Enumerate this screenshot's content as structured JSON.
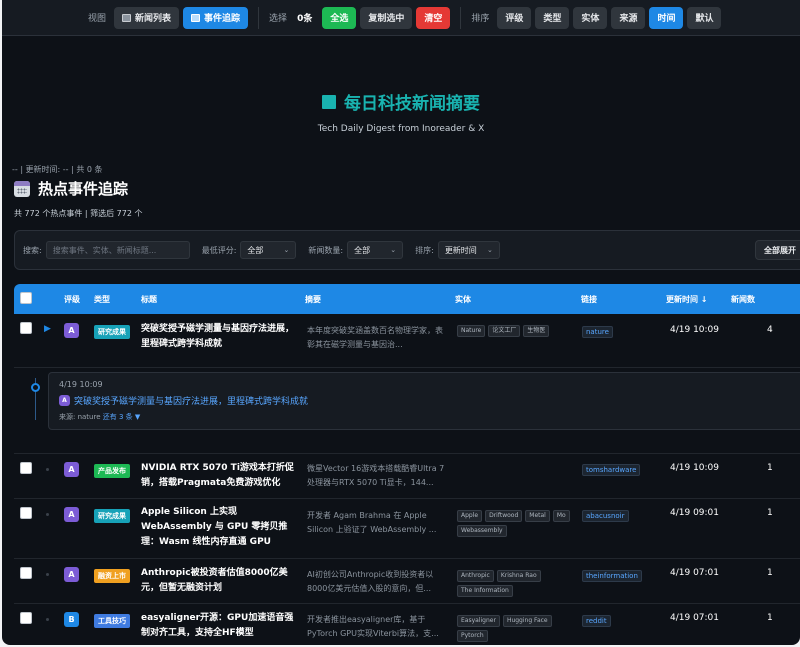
{
  "toolbar": {
    "view_label": "视图",
    "view_news": "新闻列表",
    "view_events": "事件追踪",
    "select_label": "选择",
    "selected_count": "0条",
    "select_all": "全选",
    "copy_selected": "复制选中",
    "clear": "清空",
    "sort_label": "排序",
    "sort_options": [
      "评级",
      "类型",
      "实体",
      "来源",
      "时间",
      "默认"
    ],
    "active_sort": "时间"
  },
  "hero": {
    "title": "每日科技新闻摘要",
    "subtitle": "Tech Daily Digest from Inoreader & X"
  },
  "meta_line": "-- | 更新时间: -- | 共 0 条",
  "section": {
    "title": "热点事件追踪",
    "stats": "共 772 个热点事件 | 筛选后 772 个"
  },
  "filters": {
    "search_label": "搜索:",
    "search_placeholder": "搜索事件、实体、新闻标题...",
    "min_grade_label": "最低评分:",
    "min_grade_value": "全部",
    "news_count_label": "新闻数量:",
    "news_count_value": "全部",
    "sort_label": "排序:",
    "sort_value": "更新时间",
    "expand_all": "全部展开"
  },
  "table": {
    "headers": {
      "grade": "评级",
      "type": "类型",
      "title": "标题",
      "summary": "摘要",
      "entities": "实体",
      "link": "链接",
      "updated": "更新时间 ↓",
      "count": "新闻数"
    },
    "rows": [
      {
        "grade": "A",
        "type": "研究成果",
        "title": "突破奖授予磁学测量与基因疗法进展，里程碑式跨学科成就",
        "summary": "本年度突破奖涵盖数百名物理学家，表彰其在磁学测量与基因治...",
        "entities": [
          "Nature",
          "论文工厂",
          "生物医"
        ],
        "link": "nature",
        "time": "4/19 10:09",
        "count": "4",
        "expanded": true
      },
      {
        "grade": "A",
        "type": "产品发布",
        "title": "NVIDIA RTX 5070 Ti游戏本打折促销，搭载Pragmata免费游戏优化",
        "summary": "微星Vector 16游戏本搭载酷睿Ultra 7处理器与RTX 5070 Ti显卡，144...",
        "entities": [],
        "link": "tomshardware",
        "time": "4/19 10:09",
        "count": "1"
      },
      {
        "grade": "A",
        "type": "研究成果",
        "title": "Apple Silicon 上实现 WebAssembly 与 GPU 零拷贝推理：Wasm 线性内存直通 GPU",
        "summary": "开发者 Agam Brahma 在 Apple Silicon 上验证了 WebAssembly ...",
        "entities": [
          "Apple",
          "Driftwood",
          "Metal",
          "Mo",
          "Webassembly"
        ],
        "link": "abacusnoir",
        "time": "4/19 09:01",
        "count": "1"
      },
      {
        "grade": "A",
        "type": "融资上市",
        "title": "Anthropic被投资者估值8000亿美元，但暂无融资计划",
        "summary": "AI初创公司Anthropic收到投资者以8000亿美元估值入股的意向，但...",
        "entities": [
          "Anthropic",
          "Krishna Rao",
          "The Information"
        ],
        "link": "theinformation",
        "time": "4/19 07:01",
        "count": "1"
      },
      {
        "grade": "B",
        "type": "工具技巧",
        "title": "easyaligner开源：GPU加速语音强制对齐工具，支持全HF模型",
        "summary": "开发者推出easyaligner库，基于PyTorch GPU实现Viterbi算法，支...",
        "entities": [
          "Easyaligner",
          "Hugging Face",
          "Pytorch"
        ],
        "link": "reddit",
        "time": "4/19 07:01",
        "count": "1"
      }
    ],
    "detail": {
      "time": "4/19 10:09",
      "grade": "A",
      "title": "突破奖授予磁学测量与基因疗法进展，里程碑式跨学科成就",
      "source_prefix": "来源: nature",
      "more": "还有 3 条 ▼"
    }
  },
  "colors": {
    "accent_blue": "#1e88e5",
    "teal_title": "#19b3b0",
    "grade_a": "#7c5cd6",
    "grade_b": "#1e88e5"
  }
}
